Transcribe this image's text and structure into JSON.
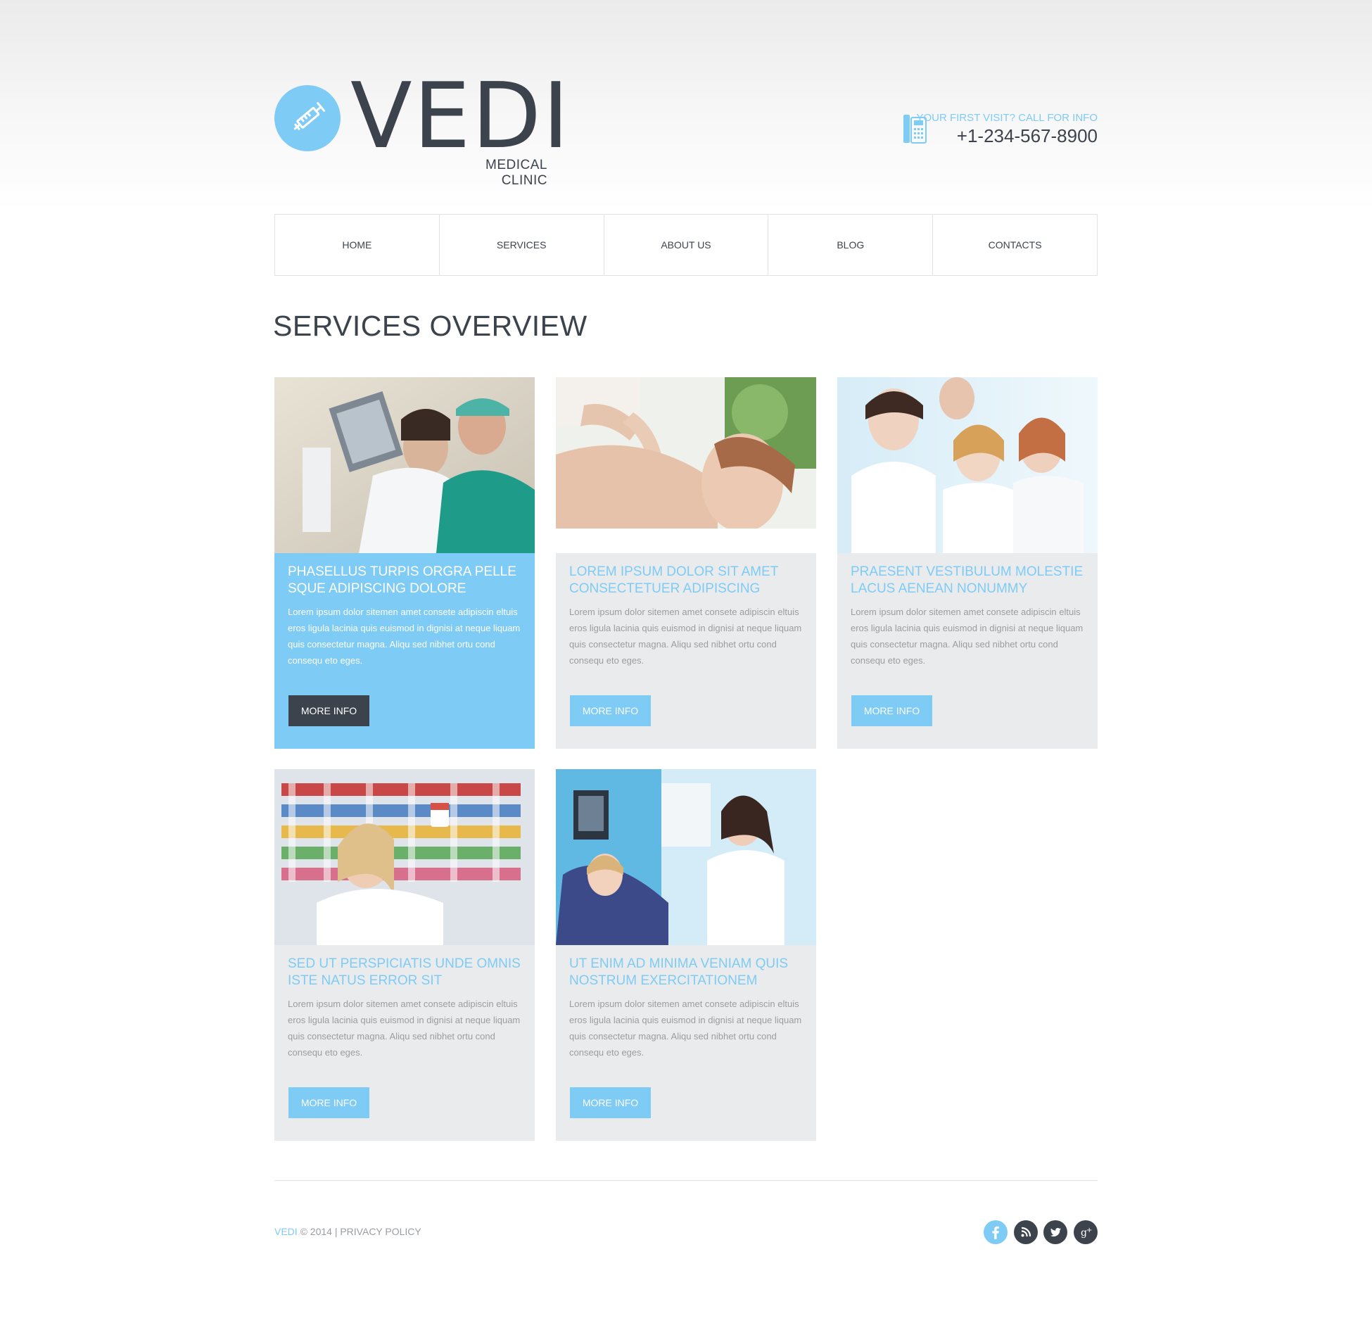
{
  "header": {
    "logo_text": "VEDI",
    "logo_subtitle": "MEDICAL CLINIC",
    "phone_caption": "YOUR FIRST VISIT? CALL FOR INFO",
    "phone_number": "+1-234-567-8900"
  },
  "nav": {
    "items": [
      {
        "label": "HOME"
      },
      {
        "label": "SERVICES"
      },
      {
        "label": "ABOUT US"
      },
      {
        "label": "BLOG"
      },
      {
        "label": "CONTACTS"
      }
    ]
  },
  "page_title": "SERVICES OVERVIEW",
  "cards": [
    {
      "title": "PHASELLUS TURPIS ORGRA PELLE SQUE ADIPISCING DOLORE",
      "text": "Lorem ipsum dolor sitemen amet consete adipiscin eltuis eros ligula lacinia quis euismod in dignisi at neque liquam quis consectetur magna. Aliqu sed nibhet ortu cond consequ eto eges.",
      "button": "MORE INFO"
    },
    {
      "title": "LOREM IPSUM DOLOR SIT AMET CONSECTETUER ADIPISCING",
      "text": "Lorem ipsum dolor sitemen amet consete adipiscin eltuis eros ligula lacinia quis euismod in dignisi at neque liquam quis consectetur magna. Aliqu sed nibhet ortu cond consequ eto eges.",
      "button": "MORE INFO"
    },
    {
      "title": "PRAESENT VESTIBULUM MOLESTIE LACUS AENEAN NONUMMY",
      "text": "Lorem ipsum dolor sitemen amet consete adipiscin eltuis eros ligula lacinia quis euismod in dignisi at neque liquam quis consectetur magna. Aliqu sed nibhet ortu cond consequ eto eges.",
      "button": "MORE INFO"
    },
    {
      "title": "SED UT PERSPICIATIS UNDE OMNIS ISTE NATUS ERROR SIT",
      "text": "Lorem ipsum dolor sitemen amet consete adipiscin eltuis eros ligula lacinia quis euismod in dignisi at neque liquam quis consectetur magna. Aliqu sed nibhet ortu cond consequ eto eges.",
      "button": "MORE INFO"
    },
    {
      "title": "UT ENIM AD MINIMA VENIAM QUIS NOSTRUM EXERCITATIONEM",
      "text": "Lorem ipsum dolor sitemen amet consete adipiscin eltuis eros ligula lacinia quis euismod in dignisi at neque liquam quis consectetur magna. Aliqu sed nibhet ortu cond consequ eto eges.",
      "button": "MORE INFO"
    }
  ],
  "footer": {
    "brand": "VEDI",
    "copyright": " © 2014 | ",
    "privacy_link": "PRIVACY POLICY",
    "social": [
      "facebook-icon",
      "rss-icon",
      "twitter-icon",
      "google-plus-icon"
    ]
  },
  "colors": {
    "accent": "#7ecbf6",
    "dark": "#3c434c",
    "card_bg": "#eaebec",
    "muted_text": "#9a9da1"
  }
}
